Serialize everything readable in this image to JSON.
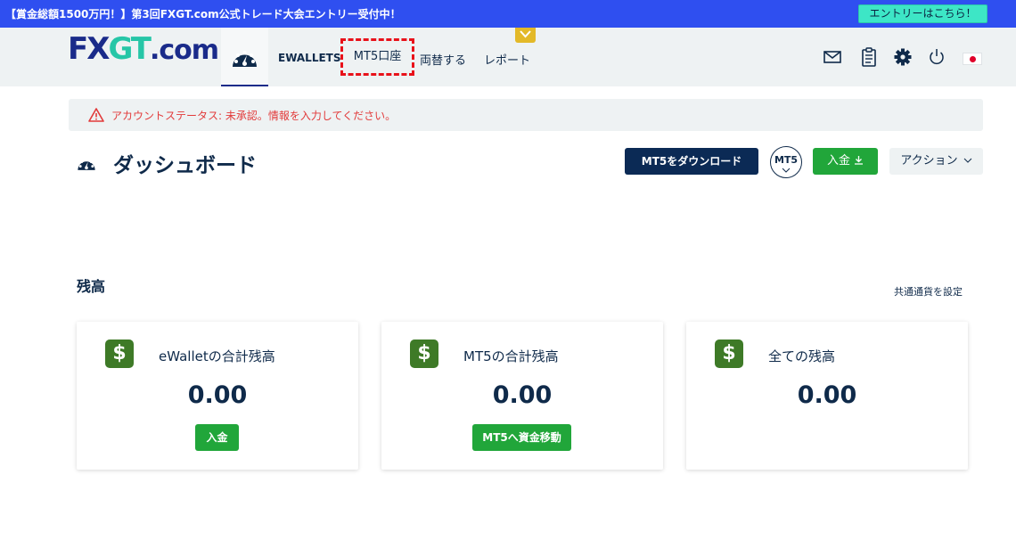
{
  "promo": {
    "text": "【賞金総額1500万円！】第3回FXGT.com公式トレード大会エントリー受付中！",
    "button": "エントリーはこちら！"
  },
  "logo": {
    "part1": "FX",
    "part2": "GT",
    "part3": ".com"
  },
  "nav": {
    "ewallets": "EWALLETS",
    "mt5_account": "MT5口座",
    "exchange": "両替する",
    "report": "レポート"
  },
  "icons": {
    "dashboard": "dashboard-gauge-icon",
    "mail": "mail-icon",
    "clipboard": "clipboard-icon",
    "settings": "gear-icon",
    "logout": "power-icon",
    "language": "japan-flag-icon"
  },
  "alert": {
    "text": "アカウントステータス: 未承認。情報を入力してください。"
  },
  "page": {
    "title": "ダッシュボード",
    "download_btn": "MT5をダウンロード",
    "platform_btn": "MT5",
    "deposit_btn": "入金",
    "action_btn": "アクション"
  },
  "balance": {
    "title": "残高",
    "currency_link": "共通通貨を設定",
    "cards": [
      {
        "title": "eWalletの合計残高",
        "amount": "0.00",
        "button": "入金"
      },
      {
        "title": "MT5の合計残高",
        "amount": "0.00",
        "button": "MT5へ資金移動"
      },
      {
        "title": "全ての残高",
        "amount": "0.00"
      }
    ]
  },
  "colors": {
    "promo_bg": "#2f4ff0",
    "promo_btn": "#3de6c6",
    "navy": "#0b2a55",
    "green": "#21a63a",
    "dollar_green": "#3e7a27",
    "alert_red": "#e23b3b",
    "highlight_red": "#e8111a",
    "collapse_yellow": "#e3b928"
  }
}
